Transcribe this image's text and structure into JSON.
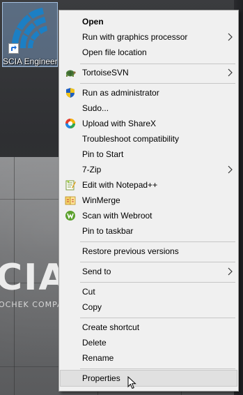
{
  "desktop": {
    "icon_label": "SCIA Engineer",
    "background_brand": "CIA",
    "background_brand_sub": "OCHEK COMPA"
  },
  "context_menu": {
    "items": [
      {
        "label": "Open",
        "bold": true
      },
      {
        "label": "Run with graphics processor",
        "submenu": true
      },
      {
        "label": "Open file location"
      },
      {
        "label": "TortoiseSVN",
        "icon": "tortoisesvn-icon",
        "submenu": true
      },
      {
        "label": "Run as administrator",
        "icon": "uac-shield-icon"
      },
      {
        "label": "Sudo..."
      },
      {
        "label": "Upload with ShareX",
        "icon": "sharex-icon"
      },
      {
        "label": "Troubleshoot compatibility"
      },
      {
        "label": "Pin to Start"
      },
      {
        "label": "7-Zip",
        "submenu": true
      },
      {
        "label": "Edit with Notepad++",
        "icon": "notepadpp-icon"
      },
      {
        "label": "WinMerge",
        "icon": "winmerge-icon"
      },
      {
        "label": "Scan with Webroot",
        "icon": "webroot-icon"
      },
      {
        "label": "Pin to taskbar"
      },
      {
        "label": "Restore previous versions"
      },
      {
        "label": "Send to",
        "submenu": true
      },
      {
        "label": "Cut"
      },
      {
        "label": "Copy"
      },
      {
        "label": "Create shortcut"
      },
      {
        "label": "Delete"
      },
      {
        "label": "Rename"
      },
      {
        "label": "Properties",
        "hovered": true
      }
    ]
  },
  "colors": {
    "menu_bg": "#f0f0f0",
    "menu_border": "#a0a0a0",
    "hover_bg": "#e0e0e0",
    "separator": "#c6c6c6",
    "icon_selection": "#99c9ff"
  }
}
